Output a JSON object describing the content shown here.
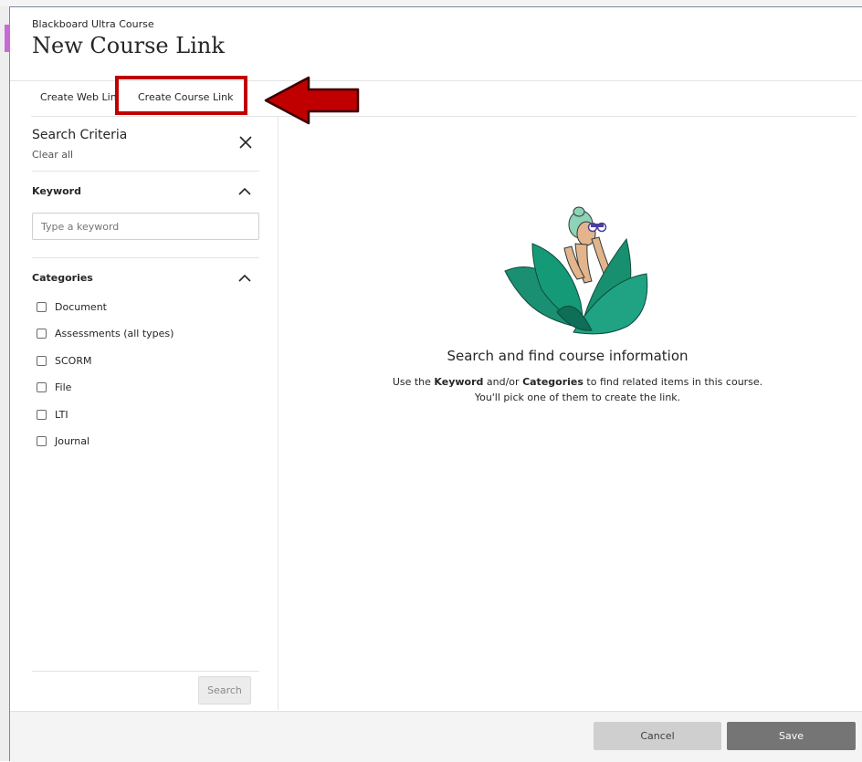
{
  "header": {
    "course_name": "Blackboard Ultra Course",
    "title": "New Course Link"
  },
  "tabs": [
    {
      "label": "Create Web Link",
      "selected": false
    },
    {
      "label": "Create Course Link",
      "selected": true
    }
  ],
  "sidebar": {
    "title": "Search Criteria",
    "clear_all": "Clear all",
    "keyword": {
      "label": "Keyword",
      "placeholder": "Type a keyword",
      "value": ""
    },
    "categories": {
      "label": "Categories",
      "items": [
        {
          "label": "Document",
          "checked": false
        },
        {
          "label": "Assessments (all types)",
          "checked": false
        },
        {
          "label": "SCORM",
          "checked": false
        },
        {
          "label": "File",
          "checked": false
        },
        {
          "label": "LTI",
          "checked": false
        },
        {
          "label": "Journal",
          "checked": false
        }
      ]
    },
    "search_button": "Search"
  },
  "empty_state": {
    "title": "Search and find course information",
    "line1_prefix": "Use the ",
    "line1_bold1": "Keyword",
    "line1_mid": " and/or ",
    "line1_bold2": "Categories",
    "line1_suffix": " to find related items in this course.",
    "line2": "You'll pick one of them to create the link."
  },
  "footer": {
    "cancel_label": "Cancel",
    "save_label": "Save"
  },
  "colors": {
    "annotation": "#c00000",
    "leaf_green": "#1a8f72",
    "save_button": "#757575"
  }
}
